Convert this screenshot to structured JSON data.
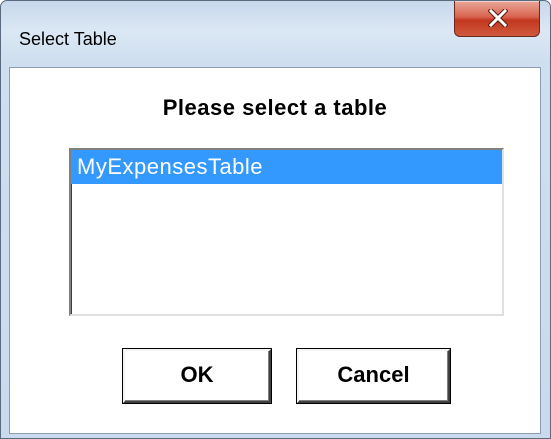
{
  "window": {
    "title": "Select Table"
  },
  "dialog": {
    "prompt": "Please select a table",
    "list": {
      "items": [
        "MyExpensesTable"
      ],
      "selected_index": 0
    },
    "buttons": {
      "ok_label": "OK",
      "cancel_label": "Cancel"
    }
  },
  "icons": {
    "close": "close-icon"
  },
  "colors": {
    "selection_bg": "#3399ff",
    "selection_text": "#ffffff",
    "close_button": "#c2371f",
    "window_frame": "#c9daee"
  }
}
